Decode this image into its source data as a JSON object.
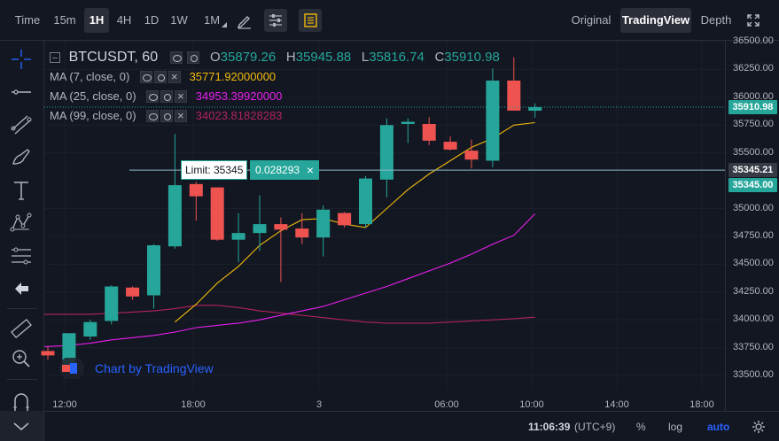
{
  "toolbar": {
    "intervals": [
      {
        "label": "Time",
        "active": false
      },
      {
        "label": "15m",
        "active": false
      },
      {
        "label": "1H",
        "active": true
      },
      {
        "label": "4H",
        "active": false
      },
      {
        "label": "1D",
        "active": false
      },
      {
        "label": "1W",
        "active": false
      },
      {
        "label": "1M",
        "active": false
      }
    ],
    "views": [
      {
        "label": "Original",
        "active": false
      },
      {
        "label": "TradingView",
        "active": true
      },
      {
        "label": "Depth",
        "active": false
      }
    ],
    "icons": [
      "pencil-icon",
      "indicator-settings-icon",
      "template-icon",
      "fullscreen-icon"
    ]
  },
  "leftbar": {
    "tools": [
      "crosshair-icon",
      "horizontal-line-icon",
      "trendline-icon",
      "brush-icon",
      "text-icon",
      "pattern-icon",
      "fibonacci-icon",
      "back-arrow-icon",
      "ruler-icon",
      "zoom-icon",
      "magnet-icon"
    ]
  },
  "legend": {
    "symbol": "BTCUSDT, 60",
    "ohlc": {
      "o_label": "O",
      "o": "35879.26",
      "h_label": "H",
      "h": "35945.88",
      "l_label": "L",
      "l": "35816.74",
      "c_label": "C",
      "c": "35910.98"
    },
    "mas": [
      {
        "label": "MA (7, close, 0)",
        "value": "35771.92000000",
        "color": "#f0b90b"
      },
      {
        "label": "MA (25, close, 0)",
        "value": "34953.39920000",
        "color": "#e91ef0"
      },
      {
        "label": "MA (99, close, 0)",
        "value": "34023.81828283",
        "color": "#b0245e"
      }
    ]
  },
  "limit_order": {
    "label": "Limit: 35345",
    "quantity": "0.028293",
    "close_glyph": "×"
  },
  "price_axis": {
    "ticks": [
      "36500.00",
      "36250.00",
      "36000.00",
      "35750.00",
      "35500.00",
      "35000.00",
      "34750.00",
      "34500.00",
      "34250.00",
      "34000.00",
      "33750.00",
      "33500.00"
    ],
    "tags": [
      {
        "value": "35910.98",
        "color": "#26a69a"
      },
      {
        "value": "35345.21",
        "color": "#363a45"
      },
      {
        "value": "35345.00",
        "color": "#26a69a"
      }
    ]
  },
  "time_axis": {
    "labels": [
      "12:00",
      "18:00",
      "3",
      "06:00",
      "10:00",
      "14:00",
      "18:00"
    ]
  },
  "watermark": "Chart by TradingView",
  "bottom_bar": {
    "clock": "11:06:39",
    "timezone": "(UTC+9)",
    "percent": "%",
    "log": "log",
    "auto": "auto"
  },
  "colors": {
    "up": "#26a69a",
    "down": "#ef5350",
    "grid": "#2a2e39",
    "accent": "#2962ff"
  },
  "chart_data": {
    "type": "candlestick",
    "ylim": [
      33250,
      36550
    ],
    "candles": [
      {
        "o": 33720,
        "h": 33760,
        "l": 33640,
        "c": 33680
      },
      {
        "o": 33560,
        "h": 33880,
        "l": 33530,
        "c": 33880
      },
      {
        "o": 33850,
        "h": 34000,
        "l": 33820,
        "c": 33980
      },
      {
        "o": 33990,
        "h": 34310,
        "l": 33960,
        "c": 34300
      },
      {
        "o": 34290,
        "h": 34300,
        "l": 34180,
        "c": 34210
      },
      {
        "o": 34220,
        "h": 34680,
        "l": 34100,
        "c": 34670
      },
      {
        "o": 34660,
        "h": 35670,
        "l": 34640,
        "c": 35210
      },
      {
        "o": 35220,
        "h": 35240,
        "l": 34890,
        "c": 35110
      },
      {
        "o": 35190,
        "h": 35190,
        "l": 34710,
        "c": 34720
      },
      {
        "o": 34720,
        "h": 34960,
        "l": 34520,
        "c": 34780
      },
      {
        "o": 34780,
        "h": 35120,
        "l": 34620,
        "c": 34860
      },
      {
        "o": 34860,
        "h": 34920,
        "l": 34340,
        "c": 34810
      },
      {
        "o": 34820,
        "h": 34960,
        "l": 34680,
        "c": 34740
      },
      {
        "o": 34740,
        "h": 35030,
        "l": 34570,
        "c": 34990
      },
      {
        "o": 34960,
        "h": 34970,
        "l": 34830,
        "c": 34850
      },
      {
        "o": 34860,
        "h": 35290,
        "l": 34830,
        "c": 35270
      },
      {
        "o": 35260,
        "h": 35810,
        "l": 35100,
        "c": 35750
      },
      {
        "o": 35760,
        "h": 35810,
        "l": 35590,
        "c": 35780
      },
      {
        "o": 35760,
        "h": 35820,
        "l": 35570,
        "c": 35610
      },
      {
        "o": 35600,
        "h": 35650,
        "l": 35520,
        "c": 35530
      },
      {
        "o": 35520,
        "h": 35620,
        "l": 35360,
        "c": 35440
      },
      {
        "o": 35430,
        "h": 36260,
        "l": 35370,
        "c": 36150
      },
      {
        "o": 36150,
        "h": 36360,
        "l": 35880,
        "c": 35880
      },
      {
        "o": 35879.26,
        "h": 35945.88,
        "l": 35816.74,
        "c": 35910.98
      }
    ],
    "ma7": [
      null,
      null,
      null,
      null,
      null,
      null,
      33980,
      34140,
      34330,
      34480,
      34670,
      34800,
      34900,
      34910,
      34860,
      34830,
      35000,
      35170,
      35310,
      35430,
      35550,
      35630,
      35750,
      35772
    ],
    "ma25": [
      33760,
      33770,
      33790,
      33820,
      33840,
      33860,
      33890,
      33930,
      33950,
      33970,
      34000,
      34040,
      34080,
      34120,
      34180,
      34240,
      34300,
      34370,
      34440,
      34510,
      34590,
      34680,
      34760,
      34953
    ],
    "ma99": [
      34050,
      34050,
      34050,
      34060,
      34070,
      34080,
      34100,
      34130,
      34130,
      34110,
      34080,
      34060,
      34040,
      34020,
      34000,
      33980,
      33970,
      33970,
      33970,
      33980,
      33990,
      34000,
      34010,
      34024
    ],
    "last_price": 35910.98,
    "limit_price": 35345
  }
}
